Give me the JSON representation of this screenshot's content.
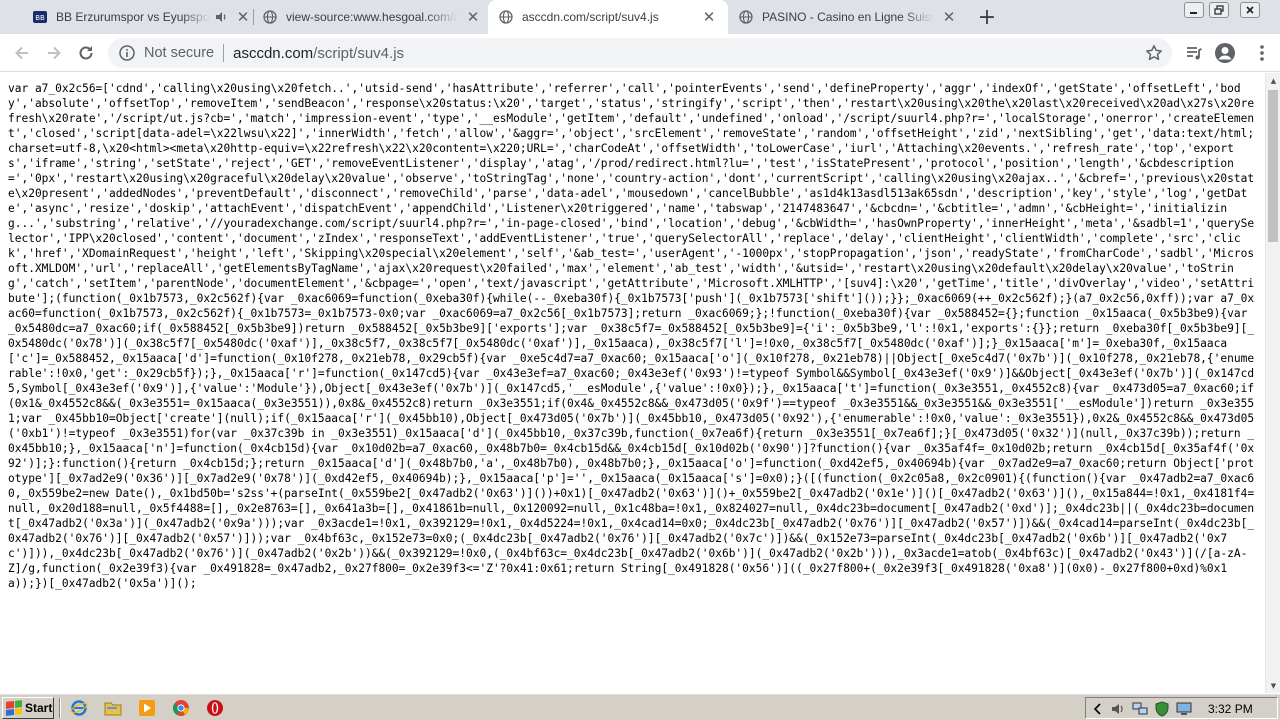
{
  "browser": {
    "tabs": [
      {
        "title": "BB Erzurumspor vs Eyupspor - H",
        "favicon": "site-favicon"
      },
      {
        "title": "view-source:www.hesgoal.com/new",
        "favicon": "globe-icon"
      },
      {
        "title": "asccdn.com/script/suv4.js",
        "favicon": "globe-icon"
      },
      {
        "title": "PASINO - Casino en Ligne Suisse - Su",
        "favicon": "globe-icon"
      }
    ],
    "new_tab_label": "+",
    "close_glyph": "✕",
    "omnibox": {
      "security_label": "Not secure",
      "url_host": "asccdn.com",
      "url_path": "/script/suv4.js"
    }
  },
  "page": {
    "source_text": "var a7_0x2c56=['cdnd','calling\\x20using\\x20fetch..','utsid-send','hasAttribute','referrer','call','pointerEvents','send','defineProperty','aggr','indexOf','getState','offsetLeft','body','absolute','offsetTop','removeItem','sendBeacon','response\\x20status:\\x20','target','status','stringify','script','then','restart\\x20using\\x20the\\x20last\\x20received\\x20ad\\x27s\\x20refresh\\x20rate','/script/ut.js?cb=','match','impression-event','type','__esModule','getItem','default','undefined','onload','/script/suurl4.php?r=','localStorage','onerror','createElement','closed','script[data-adel=\\x22lwsu\\x22]','innerWidth','fetch','allow','&aggr=','object','srcElement','removeState','random','offsetHeight','zid','nextSibling','get','data:text/html;charset=utf-8,\\x20<html><meta\\x20http-equiv=\\x22refresh\\x22\\x20content=\\x220;URL=','charCodeAt','offsetWidth','toLowerCase','iurl','Attaching\\x20events.','refresh_rate','top','exports','iframe','string','setState','reject','GET','removeEventListener','display','atag','/prod/redirect.html?lu=','test','isStatePresent','protocol','position','length','&cbdescription=','0px','restart\\x20using\\x20graceful\\x20delay\\x20value','observe','toStringTag','none','country-action','dont','currentScript','calling\\x20using\\x20ajax..','&cbref=','previous\\x20state\\x20present','addedNodes','preventDefault','disconnect','removeChild','parse','data-adel','mousedown','cancelBubble','as1d4k13asdl513ak65sdn','description','key','style','log','getDate','async','resize','doskip','attachEvent','dispatchEvent','appendChild','Listener\\x20triggered','name','tabswap','2147483647','&cbcdn=','&cbtitle=','admn','&cbHeight=','initializing...','substring','relative','//youradexchange.com/script/suurl4.php?r=','in-page-closed','bind','location','debug','&cbWidth=','hasOwnProperty','innerHeight','meta','&sadbl=1','querySelector','IPP\\x20closed','content','document','zIndex','responseText','addEventListener','true','querySelectorAll','replace','delay','clientHeight','clientWidth','complete','src','click','href','XDomainRequest','height','left','Skipping\\x20special\\x20element','self','&ab_test=','userAgent','-1000px','stopPropagation','json','readyState','fromCharCode','sadbl','Microsoft.XMLDOM','url','replaceAll','getElementsByTagName','ajax\\x20request\\x20failed','max','element','ab_test','width','&utsid=','restart\\x20using\\x20default\\x20delay\\x20value','toString','catch','setItem','parentNode','documentElement','&cbpage=','open','text/javascript','getAttribute','Microsoft.XMLHTTP','[suv4]:\\x20','getTime','title','divOverlay','video','setAttribute'];(function(_0x1b7573,_0x2c562f){var _0xac6069=function(_0xeba30f){while(--_0xeba30f){_0x1b7573['push'](_0x1b7573['shift']());}};_0xac6069(++_0x2c562f);}(a7_0x2c56,0xff));var a7_0xac60=function(_0x1b7573,_0x2c562f){_0x1b7573=_0x1b7573-0x0;var _0xac6069=a7_0x2c56[_0x1b7573];return _0xac6069;};!function(_0xeba30f){var _0x588452={};function _0x15aaca(_0x5b3be9){var _0x5480dc=a7_0xac60;if(_0x588452[_0x5b3be9])return _0x588452[_0x5b3be9]['exports'];var _0x38c5f7=_0x588452[_0x5b3be9]={'i':_0x5b3be9,'l':!0x1,'exports':{}};return _0xeba30f[_0x5b3be9][_0x5480dc('0x78')](_0x38c5f7[_0x5480dc('0xaf')],_0x38c5f7,_0x38c5f7[_0x5480dc('0xaf')],_0x15aaca),_0x38c5f7['l']=!0x0,_0x38c5f7[_0x5480dc('0xaf')];}_0x15aaca['m']=_0xeba30f,_0x15aaca['c']=_0x588452,_0x15aaca['d']=function(_0x10f278,_0x21eb78,_0x29cb5f){var _0xe5c4d7=a7_0xac60;_0x15aaca['o'](_0x10f278,_0x21eb78)||Object[_0xe5c4d7('0x7b')](_0x10f278,_0x21eb78,{'enumerable':!0x0,'get':_0x29cb5f});},_0x15aaca['r']=function(_0x147cd5){var _0x43e3ef=a7_0xac60;_0x43e3ef('0x93')!=typeof Symbol&&Symbol[_0x43e3ef('0x9')]&&Object[_0x43e3ef('0x7b')](_0x147cd5,Symbol[_0x43e3ef('0x9')],{'value':'Module'}),Object[_0x43e3ef('0x7b')](_0x147cd5,'__esModule',{'value':!0x0});},_0x15aaca['t']=function(_0x3e3551,_0x4552c8){var _0x473d05=a7_0xac60;if(0x1&_0x4552c8&&(_0x3e3551=_0x15aaca(_0x3e3551)),0x8&_0x4552c8)return _0x3e3551;if(0x4&_0x4552c8&&_0x473d05('0x9f')==typeof _0x3e3551&&_0x3e3551&&_0x3e3551['__esModule'])return _0x3e3551;var _0x45bb10=Object['create'](null);if(_0x15aaca['r'](_0x45bb10),Object[_0x473d05('0x7b')](_0x45bb10,_0x473d05('0x92'),{'enumerable':!0x0,'value':_0x3e3551}),0x2&_0x4552c8&&_0x473d05('0xb1')!=typeof _0x3e3551)for(var _0x37c39b in _0x3e3551)_0x15aaca['d'](_0x45bb10,_0x37c39b,function(_0x7ea6f){return _0x3e3551[_0x7ea6f];}[_0x473d05('0x32')](null,_0x37c39b));return _0x45bb10;},_0x15aaca['n']=function(_0x4cb15d){var _0x10d02b=a7_0xac60,_0x48b7b0=_0x4cb15d&&_0x4cb15d[_0x10d02b('0x90')]?function(){var _0x35af4f=_0x10d02b;return _0x4cb15d[_0x35af4f('0x92')];}:function(){return _0x4cb15d;};return _0x15aaca['d'](_0x48b7b0,'a',_0x48b7b0),_0x48b7b0;},_0x15aaca['o']=function(_0xd42ef5,_0x40694b){var _0x7ad2e9=a7_0xac60;return Object['prototype'][_0x7ad2e9('0x36')][_0x7ad2e9('0x78')](_0xd42ef5,_0x40694b);},_0x15aaca['p']='',_0x15aaca(_0x15aaca['s']=0x0);}([(function(_0x2c05a8,_0x2c0901){(function(){var _0x47adb2=a7_0xac60,_0x559be2=new Date(),_0x1bd50b='s2ss'+(parseInt(_0x559be2[_0x47adb2('0x63')]())+0x1)[_0x47adb2('0x63')]()+_0x559be2[_0x47adb2('0x1e')]()[_0x47adb2('0x63')](),_0x15a844=!0x1,_0x4181f4=null,_0x20d188=null,_0x5f4488=[],_0x2e8763=[],_0x641a3b=[],_0x41861b=null,_0x120092=null,_0x1c48ba=!0x1,_0x824027=null,_0x4dc23b=document[_0x47adb2('0xd')];_0x4dc23b||(_0x4dc23b=document[_0x47adb2('0x3a')](_0x47adb2('0x9a')));var _0x3acde1=!0x1,_0x392129=!0x1,_0x4d5224=!0x1,_0x4cad14=0x0;_0x4dc23b[_0x47adb2('0x76')][_0x47adb2('0x57')])&&(_0x4cad14=parseInt(_0x4dc23b[_0x47adb2('0x76')][_0x47adb2('0x57')]));var _0x4bf63c,_0x152e73=0x0;(_0x4dc23b[_0x47adb2('0x76')][_0x47adb2('0x7c')])&&(_0x152e73=parseInt(_0x4dc23b[_0x47adb2('0x6b')][_0x47adb2('0x7c')])),_0x4dc23b[_0x47adb2('0x76')](_0x47adb2('0x2b'))&&(_0x392129=!0x0,(_0x4bf63c=_0x4dc23b[_0x47adb2('0x6b')](_0x47adb2('0x2b'))),_0x3acde1=atob(_0x4bf63c)[_0x47adb2('0x43')](/[a-zA-Z]/g,function(_0x2e39f3){var _0x491828=_0x47adb2,_0x27f800=_0x2e39f3<='Z'?0x41:0x61;return String[_0x491828('0x56')]((_0x27f800+(_0x2e39f3[_0x491828('0xa8')](0x0)-_0x27f800+0xd)%0x1a));})[_0x47adb2('0x5a')]();"
  },
  "taskbar": {
    "start_label": "Start",
    "clock": "3:32 PM"
  },
  "colors": {
    "tab_strip": "#dee1e6",
    "omnibox_bg": "#f1f3f4",
    "taskbar": "#d4d0c8",
    "start_flag": [
      "#e8412c",
      "#3fae3c",
      "#2d6fd9",
      "#f7c600"
    ]
  }
}
